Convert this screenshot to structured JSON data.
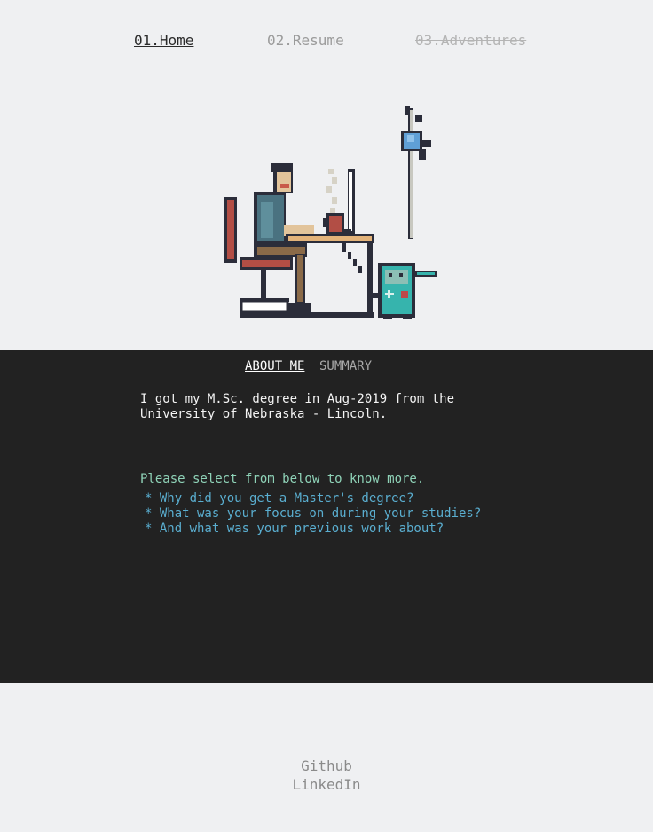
{
  "nav": {
    "home": "01.Home",
    "resume": "02.Resume",
    "adventures": "03.Adventures"
  },
  "illustration": {
    "icon": "developer-at-desk-pixel-art-icon"
  },
  "panel": {
    "tabs": {
      "about": "ABOUT ME",
      "summary": "SUMMARY"
    },
    "intro_line1": "I got my M.Sc. degree in Aug-2019 from the",
    "intro_line2": "University of Nebraska - Lincoln.",
    "prompt": "Please select from below to know more.",
    "questions": [
      "* Why did you get a Master's degree?",
      "* What was your focus on during your studies?",
      "* And what was your previous work about?"
    ]
  },
  "footer": {
    "github": "Github",
    "linkedin": "LinkedIn"
  },
  "colors": {
    "background": "#eff0f2",
    "panel": "#222222",
    "prompt": "#8fd3b8",
    "links": "#5aaed0"
  }
}
